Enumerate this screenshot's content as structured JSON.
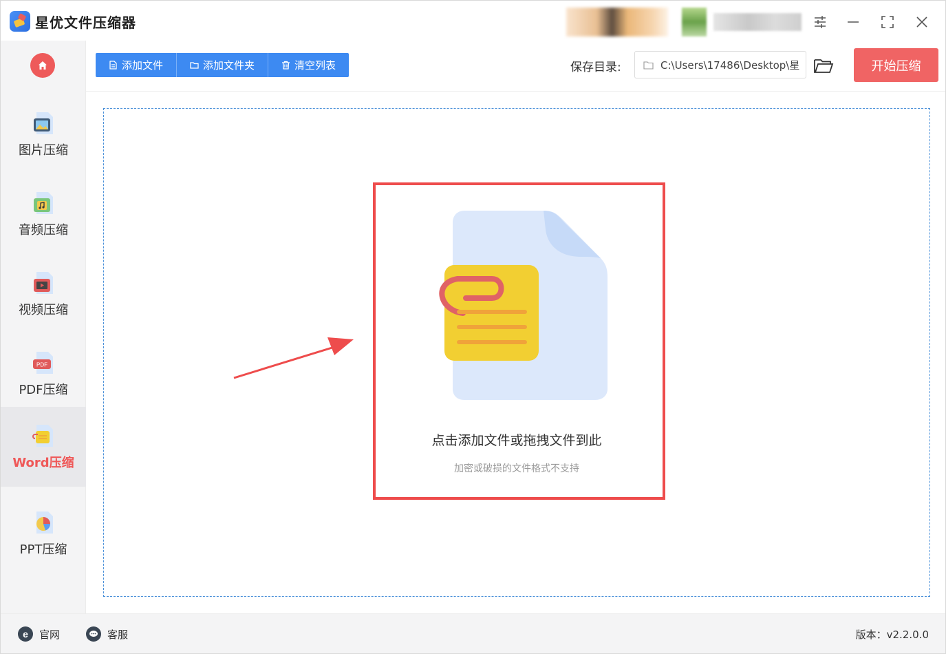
{
  "app": {
    "title": "星优文件压缩器"
  },
  "sidebar": {
    "items": [
      {
        "label": "图片压缩",
        "icon": "image-icon"
      },
      {
        "label": "音频压缩",
        "icon": "music-icon"
      },
      {
        "label": "视频压缩",
        "icon": "video-icon"
      },
      {
        "label": "PDF压缩",
        "icon": "pdf-icon",
        "badge": "PDF"
      },
      {
        "label": "Word压缩",
        "icon": "word-icon",
        "active": true
      },
      {
        "label": "PPT压缩",
        "icon": "ppt-icon"
      }
    ]
  },
  "toolbar": {
    "add_file": "添加文件",
    "add_folder": "添加文件夹",
    "clear_list": "清空列表",
    "save_dir_label": "保存目录:",
    "save_path": "C:\\Users\\17486\\Desktop\\星",
    "start_button": "开始压缩"
  },
  "dropzone": {
    "title": "点击添加文件或拖拽文件到此",
    "subtitle": "加密或破损的文件格式不支持"
  },
  "footer": {
    "website": "官网",
    "support": "客服",
    "version": "版本：v2.2.0.0"
  },
  "colors": {
    "primary_blue": "#3d8af2",
    "accent_red": "#f06464",
    "highlight_red": "#ee4c4c",
    "sidebar_bg": "#f4f4f5"
  }
}
